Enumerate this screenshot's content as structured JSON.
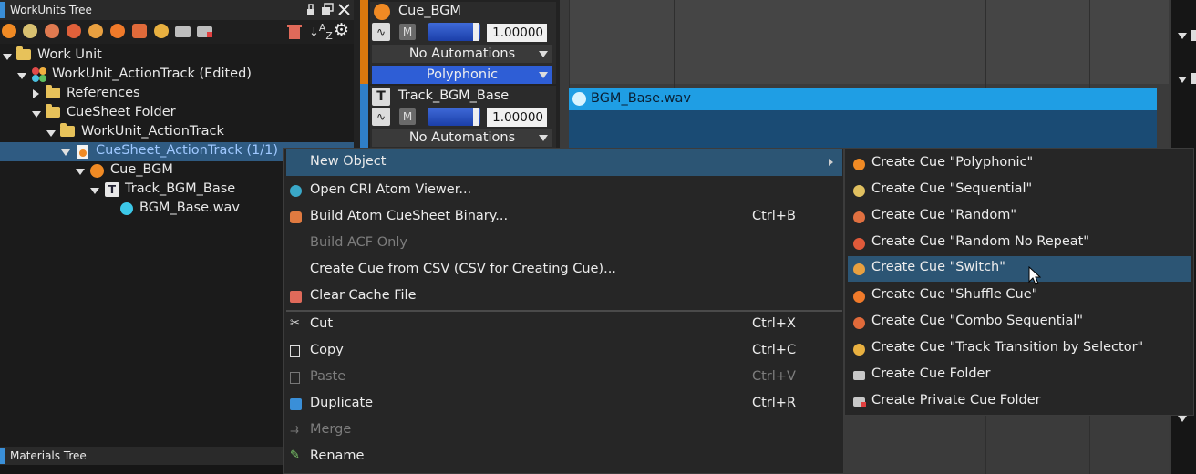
{
  "tree_panel": {
    "title": "WorkUnits Tree",
    "items": [
      {
        "label": "Work Unit"
      },
      {
        "label": "WorkUnit_ActionTrack (Edited)"
      },
      {
        "label": "References"
      },
      {
        "label": "CueSheet Folder"
      },
      {
        "label": "WorkUnit_ActionTrack"
      },
      {
        "label": "CueSheet_ActionTrack (1/1)"
      },
      {
        "label": "Cue_BGM"
      },
      {
        "label": "Track_BGM_Base"
      },
      {
        "label": "BGM_Base.wav"
      }
    ]
  },
  "materials_panel": {
    "title": "Materials Tree"
  },
  "tracks": {
    "cue": {
      "name": "Cue_BGM",
      "mute": "M",
      "volume": "1.00000",
      "automation": "No Automations",
      "type": "Polyphonic"
    },
    "track": {
      "name": "Track_BGM_Base",
      "icon_letter": "T",
      "mute": "M",
      "volume": "1.00000",
      "automation": "No Automations"
    }
  },
  "timeline": {
    "clip_label": "BGM_Base.wav"
  },
  "context_menu": {
    "items": [
      {
        "label": "New Object"
      },
      {
        "label": "Open CRI Atom Viewer..."
      },
      {
        "label": "Build Atom CueSheet Binary...",
        "shortcut": "Ctrl+B"
      },
      {
        "label": "Build ACF Only"
      },
      {
        "label": "Create Cue from CSV (CSV for Creating Cue)..."
      },
      {
        "label": "Clear Cache File"
      },
      {
        "label": "Cut",
        "shortcut": "Ctrl+X"
      },
      {
        "label": "Copy",
        "shortcut": "Ctrl+C"
      },
      {
        "label": "Paste",
        "shortcut": "Ctrl+V"
      },
      {
        "label": "Duplicate",
        "shortcut": "Ctrl+R"
      },
      {
        "label": "Merge"
      },
      {
        "label": "Rename"
      }
    ]
  },
  "submenu": {
    "items": [
      {
        "label": "Create Cue \"Polyphonic\"",
        "color": "#f08a24"
      },
      {
        "label": "Create Cue \"Sequential\"",
        "color": "#e0c060"
      },
      {
        "label": "Create Cue \"Random\"",
        "color": "#e07040"
      },
      {
        "label": "Create Cue \"Random No Repeat\"",
        "color": "#e05a3a"
      },
      {
        "label": "Create Cue \"Switch\"",
        "color": "#e8a040"
      },
      {
        "label": "Create Cue \"Shuffle Cue\"",
        "color": "#f07a2a"
      },
      {
        "label": "Create Cue \"Combo Sequential\"",
        "color": "#e06a3a"
      },
      {
        "label": "Create Cue \"Track Transition by Selector\"",
        "color": "#e8b040"
      },
      {
        "label": "Create Cue Folder",
        "color": "#c8c8c8"
      },
      {
        "label": "Create Private Cue Folder",
        "color": "#c8c8c8"
      }
    ]
  }
}
